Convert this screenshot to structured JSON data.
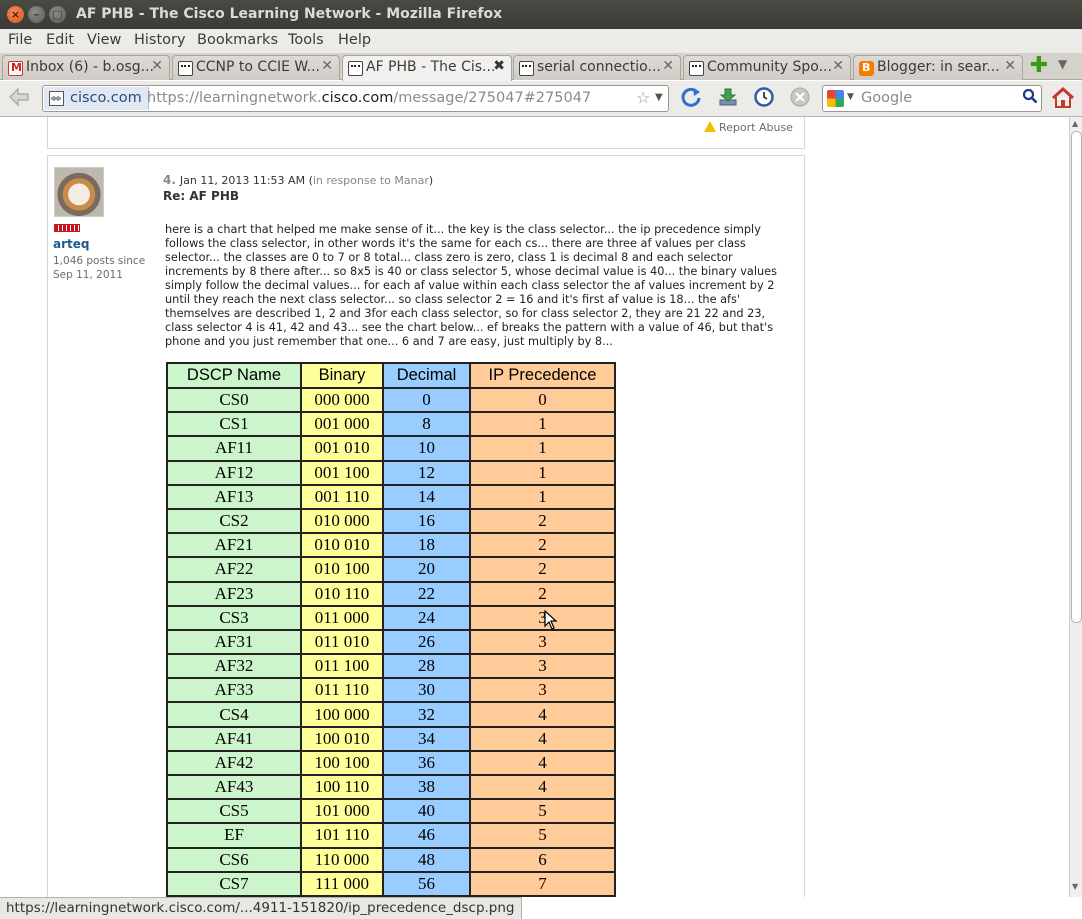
{
  "window": {
    "title": "AF PHB - The Cisco Learning Network - Mozilla Firefox"
  },
  "menu": [
    "File",
    "Edit",
    "View",
    "History",
    "Bookmarks",
    "Tools",
    "Help"
  ],
  "tabs": [
    {
      "label": "Inbox (6) - b.osg...",
      "icon": "gmail-icon"
    },
    {
      "label": "CCNP to CCIE W...",
      "icon": "cisco-icon"
    },
    {
      "label": "AF PHB - The Cis...",
      "icon": "cisco-icon"
    },
    {
      "label": "serial connectio...",
      "icon": "cisco-icon"
    },
    {
      "label": "Community Spo...",
      "icon": "cisco-icon"
    },
    {
      "label": "Blogger: in sear...",
      "icon": "blogger-icon"
    }
  ],
  "nav": {
    "site": "cisco.com",
    "url_prefix": "https://learningnetwork.",
    "url_domain": "cisco.com",
    "url_suffix": "/message/275047#275047",
    "search_placeholder": "Google"
  },
  "report_abuse": "Report Abuse",
  "post": {
    "number": "4.",
    "date": "Jan 11, 2013 11:53 AM",
    "in_response_prefix": "(",
    "in_response": "in response to Manar",
    "in_response_suffix": ")",
    "subject": "Re: AF PHB",
    "author": "arteq",
    "author_stats": "1,046 posts since Sep 11, 2011",
    "body": "here is a chart that helped me make sense of it... the key is the class selector... the ip precedence simply follows the class selector, in other words it's the same for each cs... there are three af values per class selector... the classes are 0 to 7 or 8 total... class zero is zero, class 1 is decimal 8 and each selector increments by 8 there after... so 8x5 is 40 or class selector 5, whose decimal value is 40... the binary values simply follow the decimal values...  for each af value within each class selector the af values increment by 2 until they reach the next class selector... so class selector 2 = 16 and it's first af value is 18... the afs' themselves are described 1, 2 and 3for each class selector, so for class selector 2, they are 21 22 and 23, class selector 4 is 41, 42 and 43... see the chart below... ef breaks the pattern with a value of 46, but that's phone and you just remember that one...  6 and 7 are easy, just multiply by 8..."
  },
  "dscp_table": {
    "headers": [
      "DSCP Name",
      "Binary",
      "Decimal",
      "IP Precedence"
    ],
    "rows": [
      [
        "CS0",
        "000 000",
        "0",
        "0"
      ],
      [
        "CS1",
        "001 000",
        "8",
        "1"
      ],
      [
        "AF11",
        "001 010",
        "10",
        "1"
      ],
      [
        "AF12",
        "001 100",
        "12",
        "1"
      ],
      [
        "AF13",
        "001 110",
        "14",
        "1"
      ],
      [
        "CS2",
        "010 000",
        "16",
        "2"
      ],
      [
        "AF21",
        "010 010",
        "18",
        "2"
      ],
      [
        "AF22",
        "010 100",
        "20",
        "2"
      ],
      [
        "AF23",
        "010 110",
        "22",
        "2"
      ],
      [
        "CS3",
        "011 000",
        "24",
        "3"
      ],
      [
        "AF31",
        "011 010",
        "26",
        "3"
      ],
      [
        "AF32",
        "011 100",
        "28",
        "3"
      ],
      [
        "AF33",
        "011 110",
        "30",
        "3"
      ],
      [
        "CS4",
        "100 000",
        "32",
        "4"
      ],
      [
        "AF41",
        "100 010",
        "34",
        "4"
      ],
      [
        "AF42",
        "100 100",
        "36",
        "4"
      ],
      [
        "AF43",
        "100 110",
        "38",
        "4"
      ],
      [
        "CS5",
        "101 000",
        "40",
        "5"
      ],
      [
        "EF",
        "101 110",
        "46",
        "5"
      ],
      [
        "CS6",
        "110 000",
        "48",
        "6"
      ],
      [
        "CS7",
        "111 000",
        "56",
        "7"
      ]
    ]
  },
  "status_bar": "https://learningnetwork.cisco.com/...4911-151820/ip_precedence_dscp.png",
  "colors": {
    "name_col": "#ccf5cc",
    "binary_col": "#ffff99",
    "decimal_col": "#99ccff",
    "precedence_col": "#ffcc99",
    "link": "#1e5a8c"
  }
}
